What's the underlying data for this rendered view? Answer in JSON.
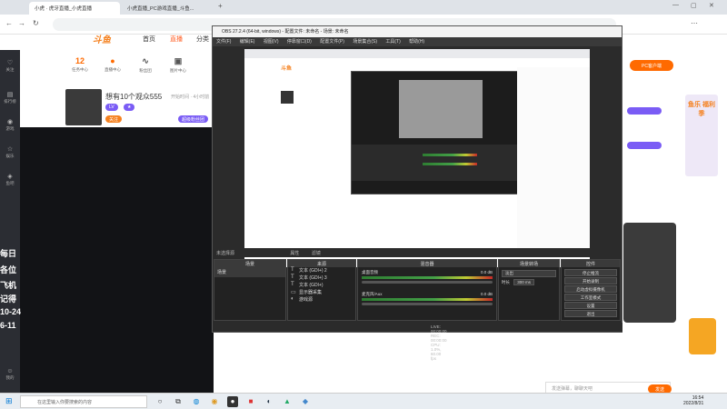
{
  "browser": {
    "tabs": [
      {
        "label": "小虎 · 虎牙直播_小虎直播"
      },
      {
        "label": "小虎直播_PC游戏直播_斗鱼..."
      }
    ]
  },
  "header": {
    "logo": "斗鱼",
    "nav": [
      "首页",
      "直播",
      "分类"
    ]
  },
  "quick_stats": [
    {
      "value": "12",
      "label": "任务中心"
    },
    {
      "value": "",
      "label": "直播中心"
    },
    {
      "value": "",
      "label": "粉丝团"
    },
    {
      "value": "",
      "label": "图片中心"
    }
  ],
  "streamer": {
    "title": "想有10个观众555",
    "meta": "开始时间 · 4小时前",
    "follow": "关注",
    "gift": "超级粉丝团"
  },
  "sidebar": {
    "items": [
      "关注",
      "排行榜",
      "游戏",
      "娱乐",
      "鱼吧",
      "我的"
    ]
  },
  "overlay_text": [
    "每日",
    "各位",
    "飞机",
    "记得",
    "10-24",
    "6-11"
  ],
  "obs": {
    "title": "OBS 27.2.4 (64-bit, windows) - 配置文件: 未命名 - 场景: 未命名",
    "menu": [
      "文件(F)",
      "编辑(E)",
      "视图(V)",
      "停靠窗口(D)",
      "配置文件(P)",
      "场景集合(S)",
      "工具(T)",
      "帮助(H)"
    ],
    "context_bar": [
      "属性",
      "滤镜"
    ],
    "source_label": "未选择源",
    "docks": {
      "scenes": "场景",
      "sources": "来源",
      "mixer": "混音器",
      "transitions": "场景转场",
      "controls": "控件"
    },
    "scene_item": "场景",
    "sources": [
      {
        "icon": "T",
        "label": "文本 (GDI+) 2"
      },
      {
        "icon": "T",
        "label": "文本 (GDI+) 3"
      },
      {
        "icon": "T",
        "label": "文本 (GDI+)"
      },
      {
        "icon": "▭",
        "label": "显示器采集"
      },
      {
        "icon": "◐",
        "label": "游戏源"
      }
    ],
    "mixer": [
      {
        "name": "桌面音频",
        "level": "0.0 dB"
      },
      {
        "name": "麦克风/Aux",
        "level": "0.0 dB"
      }
    ],
    "transition": {
      "type": "淡出",
      "duration_label": "时长",
      "duration": "300 ms"
    },
    "controls": [
      "停止推流",
      "开始录制",
      "启动虚拟摄像机",
      "工作室模式",
      "设置",
      "退出"
    ],
    "status": "LIVE: 00:00:00  REC: 00:00:00  CPU: 1.0%, 60.00 fps"
  },
  "right": {
    "pc_button": "PC客户端",
    "banner_title": "鱼乐 福利季",
    "chat_placeholder": "发送弹幕，聊聊天吧",
    "send": "发送"
  },
  "taskbar": {
    "search_placeholder": "在这里输入你要搜索的内容",
    "time": "16:54",
    "date": "2022/8/31"
  },
  "colors": {
    "accent": "#ff6a00",
    "obs_bg": "#2b2b2b",
    "sidebar_bg": "#2b2d33"
  }
}
